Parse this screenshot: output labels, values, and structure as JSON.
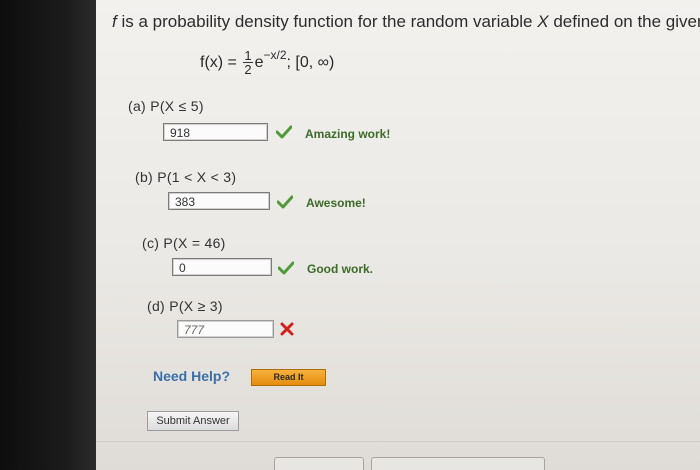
{
  "question": {
    "prefix": "f",
    "text": " is a probability density function for the random variable ",
    "var": "X",
    "suffix": " defined on the given i"
  },
  "formula": {
    "lhs": "f(x) = ",
    "frac_num": "1",
    "frac_den": "2",
    "base": "e",
    "exponent": "−x/2",
    "domain": ";   [0, ∞)"
  },
  "parts": [
    {
      "label": "(a)   P(X ≤ 5)",
      "answer": "918",
      "status": "correct",
      "feedback": "Amazing work!"
    },
    {
      "label": "(b)   P(1 < X < 3)",
      "answer": "383",
      "status": "correct",
      "feedback": "Awesome!"
    },
    {
      "label": "(c)   P(X = 46)",
      "answer": "0",
      "status": "correct",
      "feedback": "Good work."
    },
    {
      "label": "(d)   P(X ≥ 3)",
      "answer": "777",
      "status": "wrong",
      "feedback": ""
    }
  ],
  "help": {
    "label": "Need Help?",
    "read_it": "Read It"
  },
  "submit_label": "Submit Answer",
  "colors": {
    "correct_green": "#4f9a3a",
    "wrong_red": "#d02020",
    "feedback_green": "#3d6b29",
    "help_blue": "#3b6fa8",
    "read_it_orange": "#f0a020"
  }
}
